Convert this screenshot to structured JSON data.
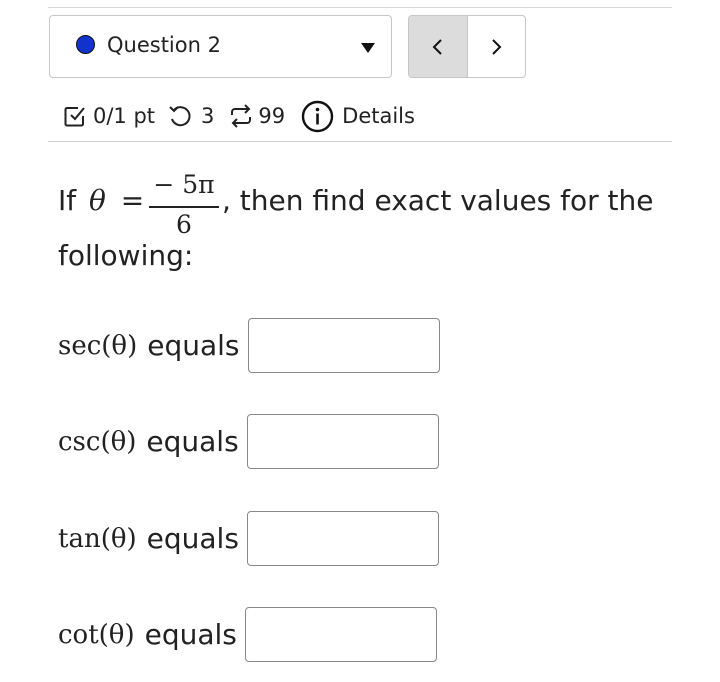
{
  "question": {
    "label": "Question 2",
    "status_color": "#1133cc"
  },
  "nav": {
    "prev_icon": "chevron-left-icon",
    "next_icon": "chevron-right-icon"
  },
  "meta": {
    "score": "0/1 pt",
    "attempts": "3",
    "versions": "99",
    "details": "Details"
  },
  "prompt": {
    "lead": "If",
    "var": "θ",
    "eq": "=",
    "num": "− 5π",
    "den": "6",
    "tail": ", then find exact values for the",
    "line2": "following:"
  },
  "answers": [
    {
      "fn": "sec(θ)",
      "label": "equals",
      "value": ""
    },
    {
      "fn": "csc(θ)",
      "label": "equals",
      "value": ""
    },
    {
      "fn": "tan(θ)",
      "label": "equals",
      "value": ""
    },
    {
      "fn": "cot(θ)",
      "label": "equals",
      "value": ""
    }
  ]
}
